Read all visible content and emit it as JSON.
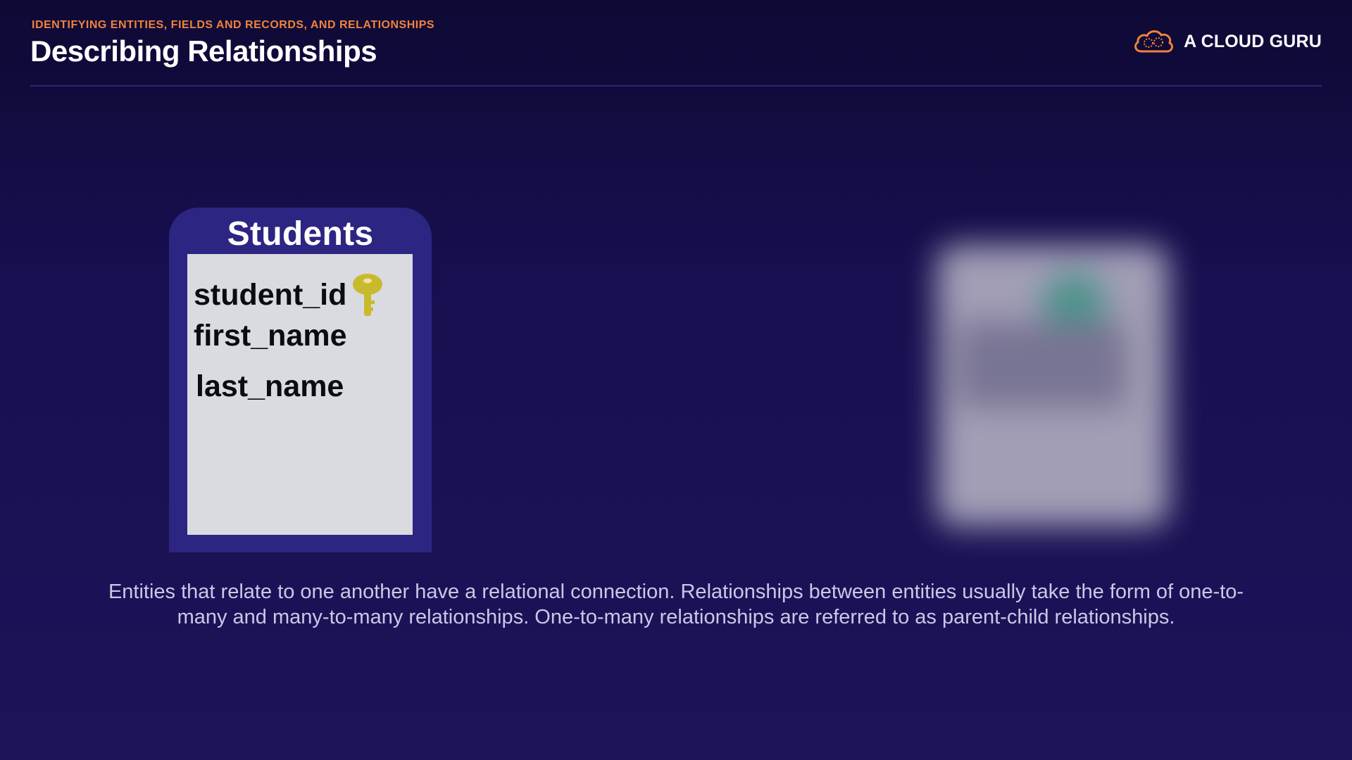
{
  "header": {
    "eyebrow": "IDENTIFYING ENTITIES, FIELDS AND RECORDS, AND RELATIONSHIPS",
    "title": "Describing Relationships",
    "logo_text": "A CLOUD GURU",
    "logo_icon": "cloud-logo-icon"
  },
  "entity": {
    "name": "Students",
    "fields": [
      "student_id",
      "first_name",
      "last_name"
    ],
    "primary_key_icon": "key-icon",
    "primary_key_color": "#c9b92d"
  },
  "caption": "Entities that relate to one another have a relational connection. Relationships between entities usually take the form of one-to-many and many-to-many relationships. One-to-many relationships are referred to as parent-child relationships.",
  "colors": {
    "background": "#1a1256",
    "accent_orange": "#f0823c",
    "card": "#2d2582",
    "card_body": "#dadbe0"
  }
}
